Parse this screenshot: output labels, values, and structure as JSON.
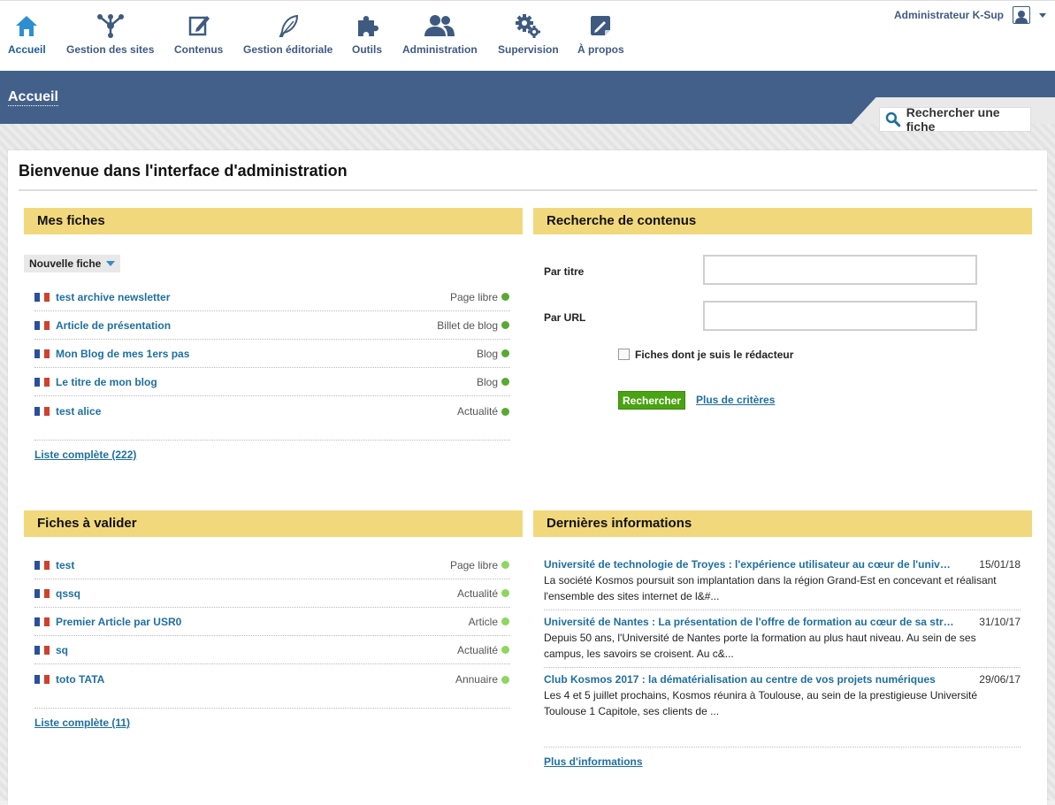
{
  "nav": {
    "items": [
      {
        "label": "Accueil",
        "icon": "home-icon"
      },
      {
        "label": "Gestion des sites",
        "icon": "sitemap-icon"
      },
      {
        "label": "Contenus",
        "icon": "edit-icon"
      },
      {
        "label": "Gestion éditoriale",
        "icon": "feather-icon"
      },
      {
        "label": "Outils",
        "icon": "puzzle-icon"
      },
      {
        "label": "Administration",
        "icon": "users-icon"
      },
      {
        "label": "Supervision",
        "icon": "gears-icon"
      },
      {
        "label": "À propos",
        "icon": "info-icon"
      }
    ],
    "user": "Administrateur K-Sup"
  },
  "header": {
    "title": "Accueil",
    "search_label": "Rechercher une fiche"
  },
  "main": {
    "welcome": "Bienvenue dans l'interface d'administration"
  },
  "mes_fiches": {
    "title": "Mes fiches",
    "new_label": "Nouvelle fiche",
    "items": [
      {
        "title": "test archive newsletter",
        "type": "Page libre"
      },
      {
        "title": "Article de présentation",
        "type": "Billet de blog"
      },
      {
        "title": "Mon Blog de mes 1ers pas",
        "type": "Blog"
      },
      {
        "title": "Le titre de mon blog",
        "type": "Blog"
      },
      {
        "title": "test alice",
        "type": "Actualité"
      }
    ],
    "more": "Liste complète (222)"
  },
  "fiches_valider": {
    "title": "Fiches à valider",
    "items": [
      {
        "title": "test",
        "type": "Page libre"
      },
      {
        "title": "qssq",
        "type": "Actualité"
      },
      {
        "title": "Premier Article par USR0",
        "type": "Article"
      },
      {
        "title": "sq",
        "type": "Actualité"
      },
      {
        "title": "toto TATA",
        "type": "Annuaire"
      }
    ],
    "more": "Liste complète (11)"
  },
  "recherche": {
    "title": "Recherche de contenus",
    "par_titre": "Par titre",
    "par_url": "Par URL",
    "titre_value": "",
    "url_value": "",
    "checkbox_label": "Fiches dont je suis le rédacteur",
    "button": "Rechercher",
    "more": "Plus de critères"
  },
  "infos": {
    "title": "Dernières informations",
    "items": [
      {
        "title": "Université de technologie de Troyes : l'expérience utilisateur au cœur de l'université",
        "date": "15/01/18",
        "desc": "La société Kosmos poursuit son implantation dans la région Grand-Est en concevant et réalisant l'ensemble des sites internet de l&#..."
      },
      {
        "title": "Université de Nantes : La présentation de l'offre de formation au cœur de sa stratégie",
        "date": "31/10/17",
        "desc": "Depuis 50 ans, l'Université de Nantes porte la formation au plus haut niveau. Au sein de ses campus, les savoirs se croisent. Au c&..."
      },
      {
        "title": "Club Kosmos 2017 : la dématérialisation au centre de vos projets numériques",
        "date": "29/06/17",
        "desc": "Les 4 et 5 juillet prochains, Kosmos réunira à Toulouse, au sein de la prestigieuse Université Toulouse 1 Capitole, ses clients de ..."
      }
    ],
    "more": "Plus d'informations"
  },
  "colors": {
    "nav_text": "#3f5a80",
    "band": "#43608a",
    "panel_header": "#f2d87c",
    "link": "#1f6f9f",
    "button_green": "#4aa312",
    "status_dark": "#5aa832",
    "status_light": "#8ed65f"
  }
}
